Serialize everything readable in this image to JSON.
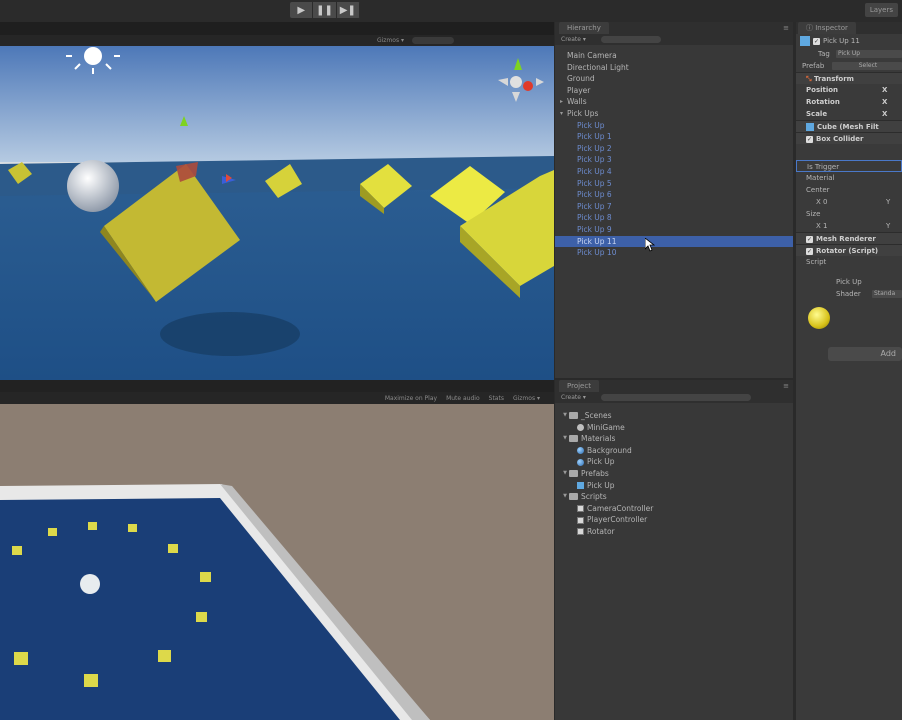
{
  "toolbar": {
    "play_icon": "play-icon",
    "pause_icon": "pause-icon",
    "step_icon": "step-icon",
    "layers": "Layers"
  },
  "scene": {
    "gizmos": "Gizmos ▾"
  },
  "game": {
    "controls": [
      "Maximize on Play",
      "Mute audio",
      "Stats",
      "Gizmos ▾"
    ]
  },
  "hierarchy": {
    "tab": "Hierarchy",
    "create": "Create ▾",
    "items": [
      {
        "label": "Main Camera",
        "level": 0,
        "arrow": ""
      },
      {
        "label": "Directional Light",
        "level": 0,
        "arrow": ""
      },
      {
        "label": "Ground",
        "level": 0,
        "arrow": ""
      },
      {
        "label": "Player",
        "level": 0,
        "arrow": ""
      },
      {
        "label": "Walls",
        "level": 0,
        "arrow": "▸"
      },
      {
        "label": "Pick Ups",
        "level": 0,
        "arrow": "▾"
      },
      {
        "label": "Pick Up",
        "level": 1
      },
      {
        "label": "Pick Up 1",
        "level": 1
      },
      {
        "label": "Pick Up 2",
        "level": 1
      },
      {
        "label": "Pick Up 3",
        "level": 1
      },
      {
        "label": "Pick Up 4",
        "level": 1
      },
      {
        "label": "Pick Up 5",
        "level": 1
      },
      {
        "label": "Pick Up 6",
        "level": 1
      },
      {
        "label": "Pick Up 7",
        "level": 1
      },
      {
        "label": "Pick Up 8",
        "level": 1
      },
      {
        "label": "Pick Up 9",
        "level": 1
      },
      {
        "label": "Pick Up 11",
        "level": 1,
        "selected": true
      },
      {
        "label": "Pick Up 10",
        "level": 1
      }
    ]
  },
  "project": {
    "tab": "Project",
    "create": "Create ▾",
    "items": [
      {
        "label": "_Scenes",
        "type": "folder",
        "level": 0
      },
      {
        "label": "MiniGame",
        "type": "scene",
        "level": 1
      },
      {
        "label": "Materials",
        "type": "folder",
        "level": 0
      },
      {
        "label": "Background",
        "type": "material",
        "level": 1
      },
      {
        "label": "Pick Up",
        "type": "material",
        "level": 1
      },
      {
        "label": "Prefabs",
        "type": "folder",
        "level": 0
      },
      {
        "label": "Pick Up",
        "type": "prefab",
        "level": 1
      },
      {
        "label": "Scripts",
        "type": "folder",
        "level": 0
      },
      {
        "label": "CameraController",
        "type": "script",
        "level": 1
      },
      {
        "label": "PlayerController",
        "type": "script",
        "level": 1
      },
      {
        "label": "Rotator",
        "type": "script",
        "level": 1
      }
    ]
  },
  "inspector": {
    "tab": "Inspector",
    "object_name": "Pick Up 11",
    "tag_label": "Tag",
    "tag_value": "Pick Up",
    "prefab_label": "Prefab",
    "prefab_btn": "Select",
    "transform": "Transform",
    "position": "Position",
    "rotation": "Rotation",
    "scale": "Scale",
    "x": "X",
    "y": "Y",
    "cube_filter": "Cube (Mesh Filt",
    "box_collider": "Box Collider",
    "is_trigger": "Is Trigger",
    "material": "Material",
    "center": "Center",
    "center_x": "X  0",
    "size": "Size",
    "size_x": "X  1",
    "mesh_renderer": "Mesh Renderer",
    "rotator": "Rotator (Script)",
    "script": "Script",
    "mat_name": "Pick Up",
    "shader": "Shader",
    "shader_value": "Standa",
    "add": "Add"
  }
}
